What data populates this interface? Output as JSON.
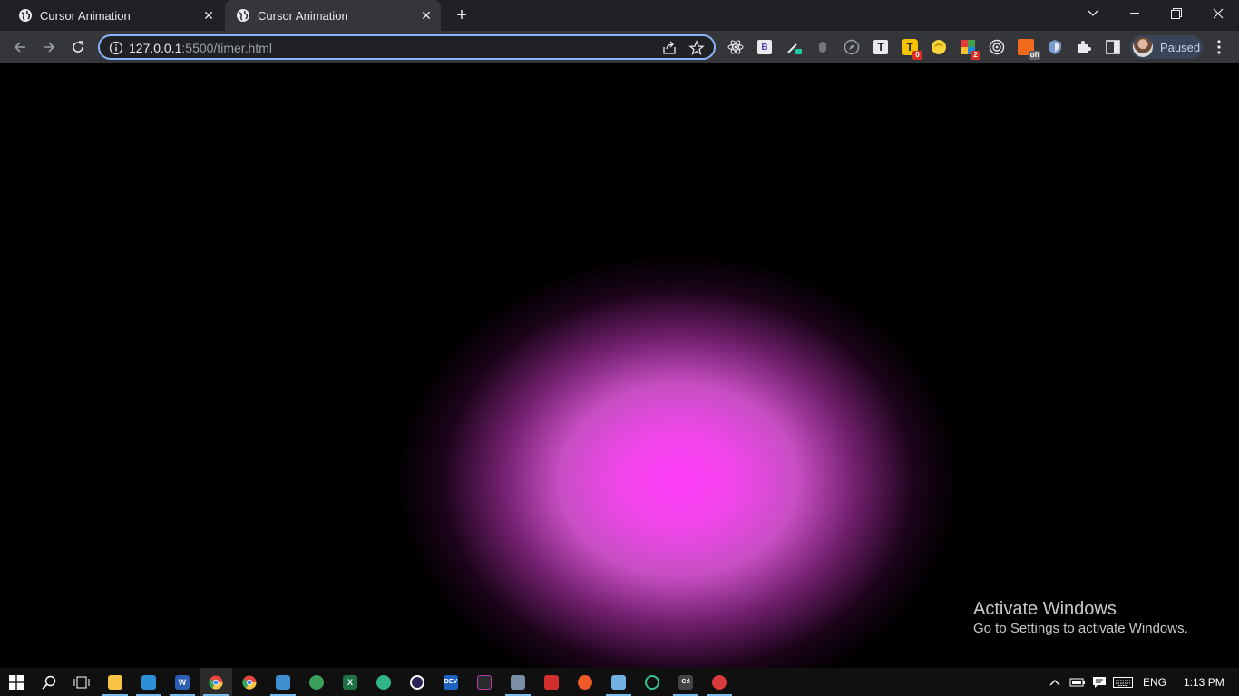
{
  "browser": {
    "tabs": [
      {
        "title": "Cursor Animation",
        "active": false
      },
      {
        "title": "Cursor Animation",
        "active": true
      }
    ],
    "new_tab_label": "+",
    "url_host": "127.0.0.1",
    "url_rest": ":5500/timer.html",
    "profile_label": "Paused",
    "extensions": [
      {
        "icon": "react-devtools-icon"
      },
      {
        "icon": "bootstrap-icon",
        "text": "B"
      },
      {
        "icon": "color-picker-icon"
      },
      {
        "icon": "mouse-icon"
      },
      {
        "icon": "compass-icon"
      },
      {
        "icon": "text-tool-icon",
        "text": "T"
      },
      {
        "icon": "toggl-icon",
        "text": "T",
        "badge": "0"
      },
      {
        "icon": "emoji-icon"
      },
      {
        "icon": "tab-manager-icon",
        "badge": "2"
      },
      {
        "icon": "target-icon"
      },
      {
        "icon": "css-extension-icon",
        "badge": "off"
      },
      {
        "icon": "shield-icon"
      },
      {
        "icon": "puzzle-icon"
      },
      {
        "icon": "sidebar-icon"
      }
    ]
  },
  "page": {
    "glow_color": "#ff3ef9",
    "background": "#000000"
  },
  "watermark": {
    "title": "Activate Windows",
    "subtitle": "Go to Settings to activate Windows."
  },
  "taskbar": {
    "apps": [
      {
        "icon": "file-explorer-icon",
        "color": "#f6c344"
      },
      {
        "icon": "vscode-icon",
        "color": "#2d8fd8"
      },
      {
        "icon": "word-icon",
        "color": "#2b5eb4",
        "text": "W"
      },
      {
        "icon": "chrome-icon",
        "color": "#e8453c"
      },
      {
        "icon": "chrome-icon",
        "color": "#e8453c"
      },
      {
        "icon": "editor-icon",
        "color": "#3e8ed0"
      },
      {
        "icon": "app-icon",
        "color": "#3aa05a"
      },
      {
        "icon": "excel-icon",
        "color": "#1e7145",
        "text": "X"
      },
      {
        "icon": "app-icon",
        "color": "#2fb686"
      },
      {
        "icon": "eclipse-icon",
        "color": "#2c2255"
      },
      {
        "icon": "dev-icon",
        "color": "#1e63c4",
        "text": "DEV"
      },
      {
        "icon": "terminal-icon",
        "color": "#b03ea6"
      },
      {
        "icon": "printer-icon",
        "color": "#7b8ea7"
      },
      {
        "icon": "media-icon",
        "color": "#d22f2f"
      },
      {
        "icon": "app-icon",
        "color": "#f05a28"
      },
      {
        "icon": "notepad-icon",
        "color": "#6fb1e3"
      },
      {
        "icon": "app-icon",
        "color": "#35c28b"
      },
      {
        "icon": "cmd-icon",
        "color": "#444444",
        "text": "C:\\"
      },
      {
        "icon": "app-icon",
        "color": "#d83b3b"
      }
    ],
    "language": "ENG",
    "time": "1:13 PM"
  }
}
